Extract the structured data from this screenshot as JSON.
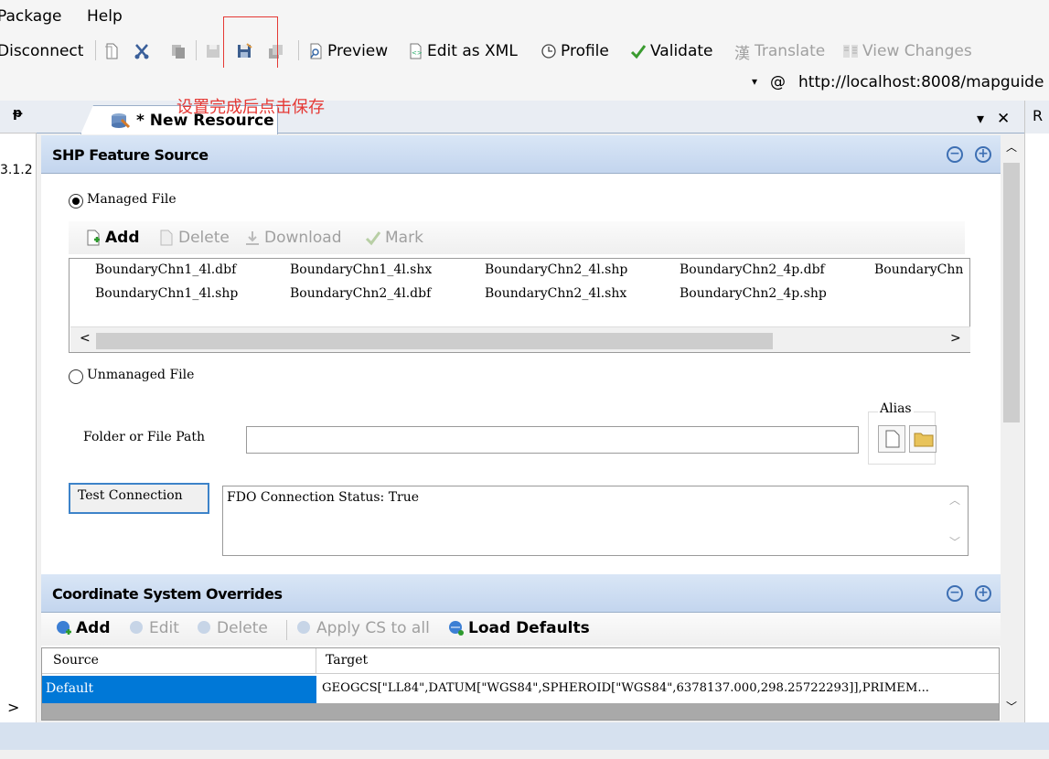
{
  "menu": {
    "package": "Package",
    "help": "Help"
  },
  "toolbar": {
    "disconnect": "Disconnect",
    "preview": "Preview",
    "edit_xml": "Edit as XML",
    "profile": "Profile",
    "validate": "Validate",
    "translate_glyph": "漢",
    "translate": "Translate",
    "view_changes": "View Changes"
  },
  "annotation": "设置完成后点击保存",
  "url": {
    "at": "@",
    "value": "http://localhost:8008/mapguide"
  },
  "left_pane": {
    "pin": "ᵽ",
    "version": "3.1.2",
    "arrow": ">"
  },
  "right_pane": {
    "label": "R"
  },
  "tab": {
    "title": "* New Resource",
    "dropdown": "▾",
    "close": "✕"
  },
  "shp_section": {
    "title": "SHP Feature Source",
    "managed_label": "Managed File",
    "file_toolbar": {
      "add": "Add",
      "delete": "Delete",
      "download": "Download",
      "mark": "Mark"
    },
    "files": [
      "BoundaryChn1_4l.dbf",
      "BoundaryChn1_4l.shx",
      "BoundaryChn2_4l.shp",
      "BoundaryChn2_4p.dbf",
      "BoundaryChn",
      "BoundaryChn1_4l.shp",
      "BoundaryChn2_4l.dbf",
      "BoundaryChn2_4l.shx",
      "BoundaryChn2_4p.shp"
    ],
    "scroll_left": "<",
    "scroll_right": ">",
    "unmanaged_label": "Unmanaged File",
    "alias_label": "Alias",
    "path_label": "Folder or File Path",
    "path_value": "",
    "test_button": "Test Connection",
    "status_text": "FDO Connection Status: True"
  },
  "cs_section": {
    "title": "Coordinate System Overrides",
    "toolbar": {
      "add": "Add",
      "edit": "Edit",
      "delete": "Delete",
      "apply": "Apply CS to all",
      "load": "Load Defaults"
    },
    "columns": [
      "Source",
      "Target"
    ],
    "rows": [
      {
        "source": "Default",
        "target": "GEOGCS[\"LL84\",DATUM[\"WGS84\",SPHEROID[\"WGS84\",6378137.000,298.25722293]],PRIMEM..."
      }
    ]
  },
  "colors": {
    "selection": "#0078d7",
    "accent": "#3d6fb3",
    "annotation": "#e53935"
  }
}
